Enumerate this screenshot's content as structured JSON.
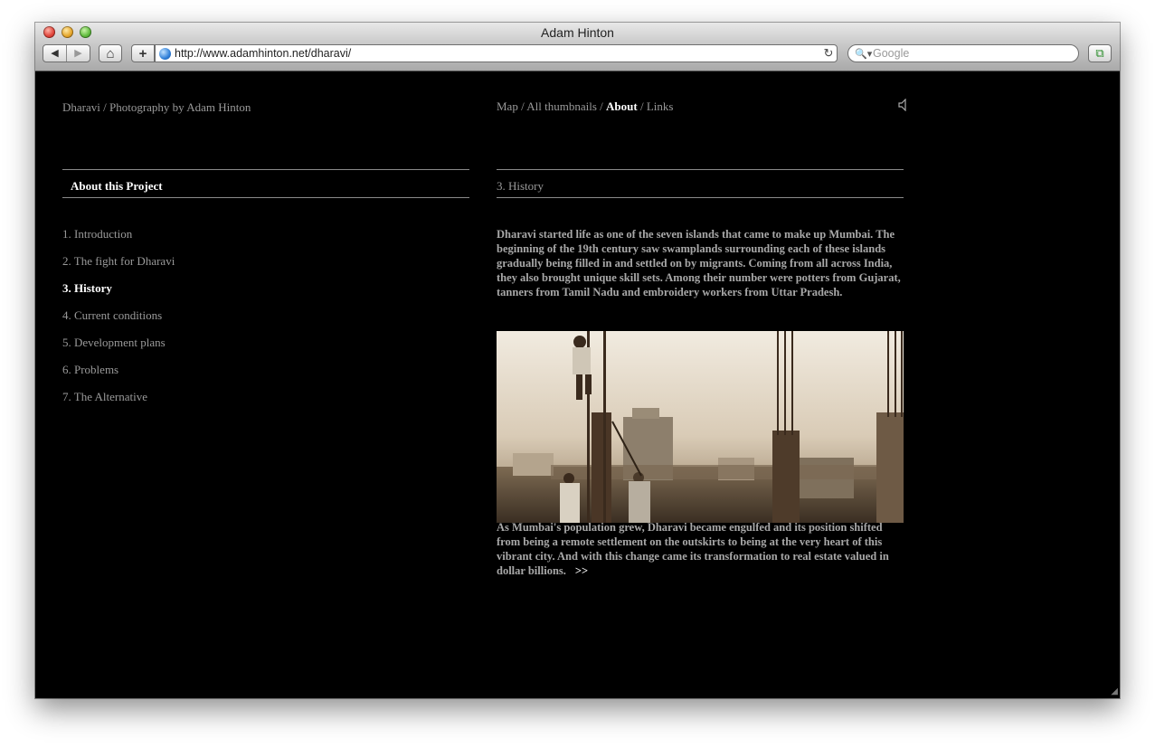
{
  "browser": {
    "window_title": "Adam Hinton",
    "url": "http://www.adamhinton.net/dharavi/",
    "search_placeholder": "Google",
    "back_icon": "◀",
    "forward_icon": "▶",
    "home_icon": "⌂",
    "add_icon": "+",
    "reload_icon": "↻",
    "search_icon": "🔍▾",
    "extension_icon": "⧉"
  },
  "site": {
    "title": "Dharavi / Photography by Adam Hinton",
    "nav": [
      {
        "label": "Map",
        "active": false
      },
      {
        "label": "All thumbnails",
        "active": false
      },
      {
        "label": "About",
        "active": true
      },
      {
        "label": "Links",
        "active": false
      }
    ],
    "speaker_icon": "🔈"
  },
  "sidebar": {
    "heading": "About this Project",
    "items": [
      {
        "label": "1. Introduction",
        "active": false
      },
      {
        "label": "2. The fight for Dharavi",
        "active": false
      },
      {
        "label": "3. History",
        "active": true
      },
      {
        "label": "4. Current conditions",
        "active": false
      },
      {
        "label": "5. Development plans",
        "active": false
      },
      {
        "label": "6. Problems",
        "active": false
      },
      {
        "label": "7. The Alternative",
        "active": false
      }
    ]
  },
  "content": {
    "heading": "3. History",
    "paragraph1": "Dharavi started life as one of the seven islands that came to make up Mumbai. The beginning of the 19th century saw swamplands surrounding each of these islands gradually being filled in and settled on by migrants. Coming from all across India, they also brought unique skill sets. Among their number were potters from Gujarat, tanners from Tamil Nadu and embroidery workers from Uttar Pradesh.",
    "paragraph2": "As Mumbai's population grew, Dharavi became engulfed and its position shifted from being a remote settlement on the outskirts to being at the very heart of this vibrant city. And with this change came its transformation to real estate valued in dollar billions.",
    "more_link": ">>"
  },
  "colors": {
    "page_bg": "#000000",
    "text_muted": "#9a9a9a",
    "text_active": "#ffffff",
    "rule": "#8a8a8a"
  }
}
